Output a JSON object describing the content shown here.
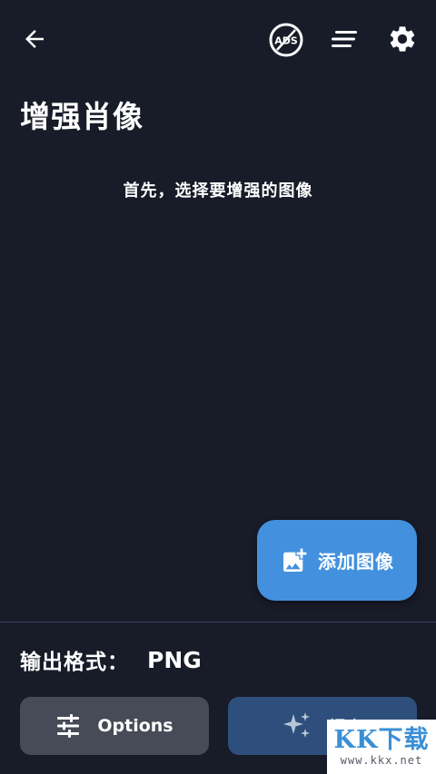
{
  "topbar": {
    "back_icon": "arrow-left-icon",
    "ads_icon": "no-ads-icon",
    "ads_text": "ADS",
    "menu_icon": "sort-lines-icon",
    "settings_icon": "gear-icon"
  },
  "page": {
    "title": "增强肖像",
    "hint": "首先，选择要增强的图像"
  },
  "fab": {
    "label": "添加图像",
    "icon": "add-photo-icon"
  },
  "output": {
    "label": "输出格式：",
    "value": "PNG"
  },
  "bottom": {
    "options_label": "Options",
    "options_icon": "sliders-icon",
    "enhance_label": "提高",
    "enhance_icon": "sparkles-icon"
  },
  "watermark": {
    "logo": "KK下载",
    "url": "www.kkx.net"
  },
  "colors": {
    "background": "#181b28",
    "accent": "#4391de",
    "options_bg": "#474b58",
    "enhance_bg": "#2e4f7b",
    "divider": "#3a4160"
  }
}
